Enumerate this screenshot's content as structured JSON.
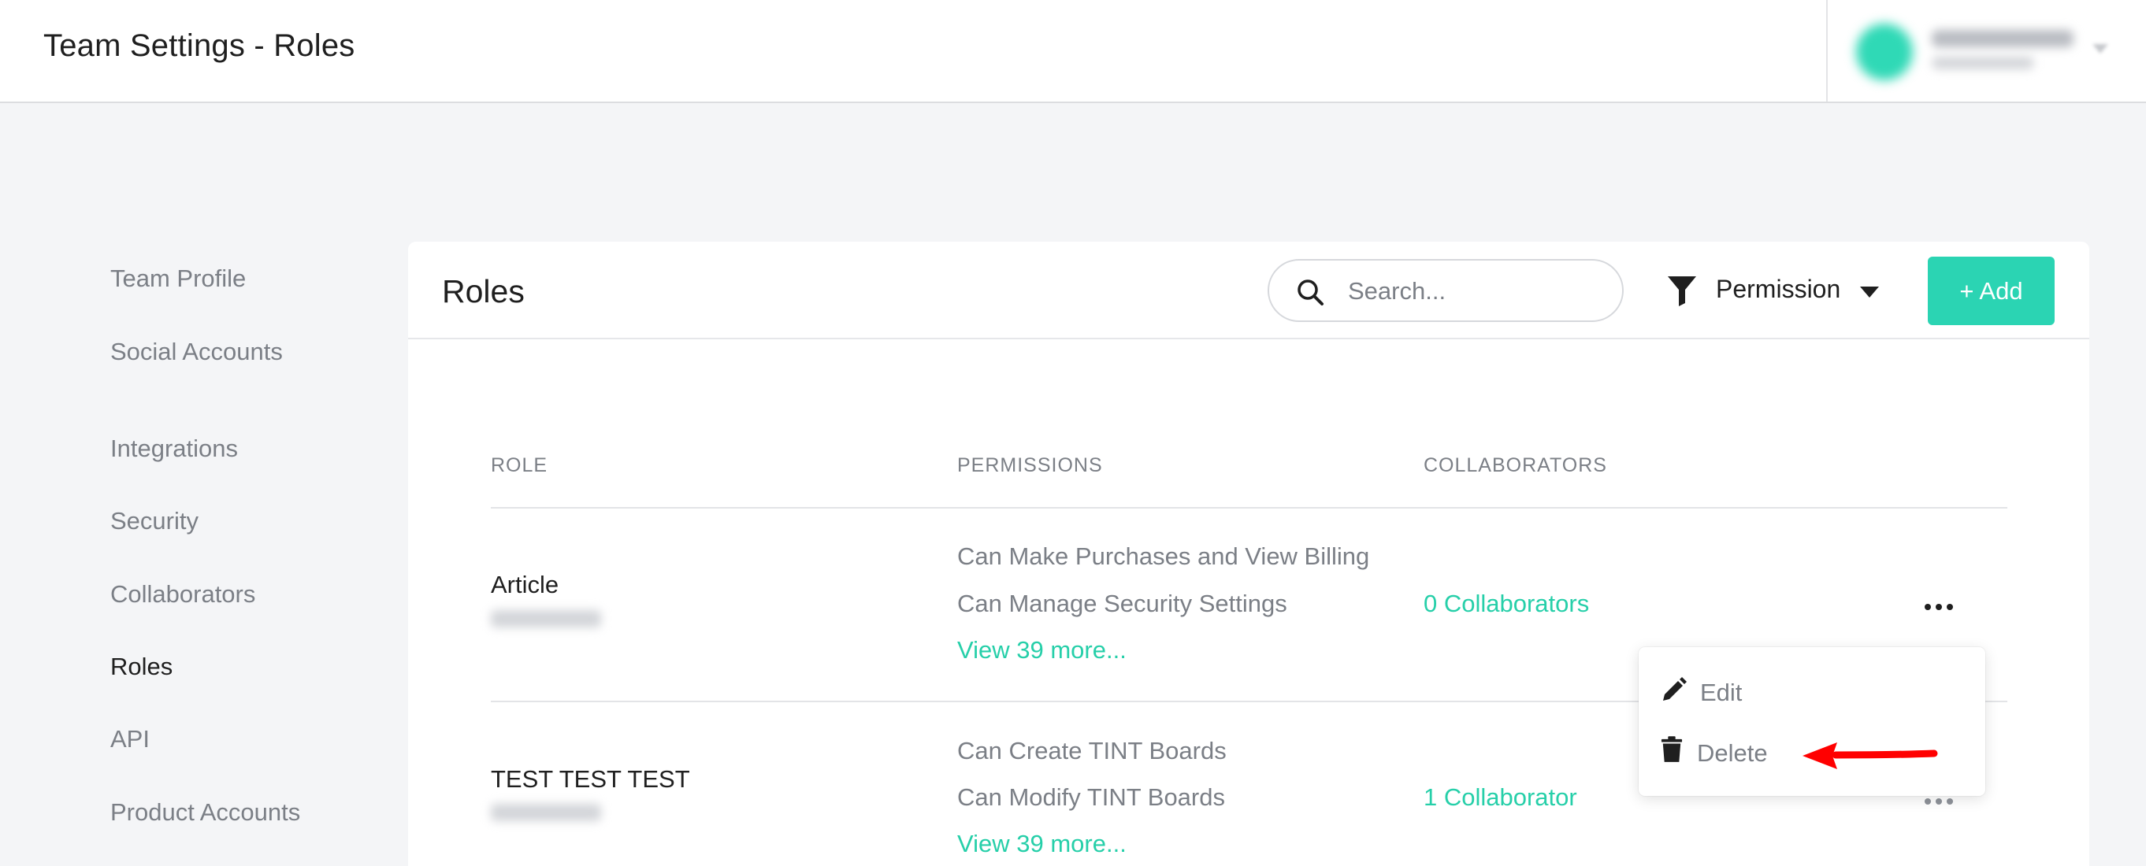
{
  "header": {
    "title": "Team Settings - Roles"
  },
  "sidebar": {
    "items": [
      {
        "label": "Team Profile"
      },
      {
        "label": "Social Accounts"
      },
      {
        "label": "Integrations"
      },
      {
        "label": "Security"
      },
      {
        "label": "Collaborators"
      },
      {
        "label": "Roles",
        "active": true
      },
      {
        "label": "API"
      },
      {
        "label": "Product Accounts"
      }
    ]
  },
  "card": {
    "title": "Roles",
    "search": {
      "placeholder": "Search...",
      "value": ""
    },
    "filter": {
      "label": "Permission"
    },
    "add_label": "+ Add"
  },
  "table": {
    "headers": [
      "ROLE",
      "PERMISSIONS",
      "COLLABORATORS"
    ],
    "rows": [
      {
        "role": "Article",
        "permissions": [
          "Can Make Purchases and View Billing",
          "Can Manage Security Settings"
        ],
        "more": "View 39 more...",
        "collaborators": "0 Collaborators"
      },
      {
        "role": "TEST TEST TEST",
        "permissions": [
          "Can Create TINT Boards",
          "Can Modify TINT Boards"
        ],
        "more": "View 39 more...",
        "collaborators": "1 Collaborator"
      }
    ]
  },
  "menu": {
    "edit": "Edit",
    "delete": "Delete"
  },
  "colors": {
    "accent": "#2bd4b3",
    "link": "#26cfa9",
    "annotation": "#ff0000"
  },
  "icons": [
    "search-icon",
    "filter-icon",
    "caret-down-icon",
    "more-options-icon",
    "pencil-icon",
    "trash-icon",
    "arrow-left-icon"
  ]
}
